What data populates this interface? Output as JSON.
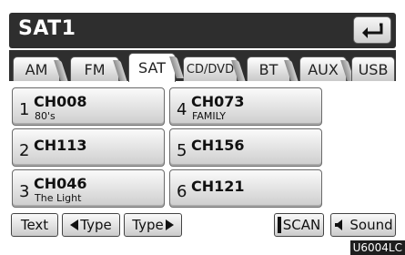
{
  "header": {
    "title": "SAT1"
  },
  "tabs": [
    {
      "label": "AM"
    },
    {
      "label": "FM"
    },
    {
      "label": "SAT",
      "active": true
    },
    {
      "label": "CD/DVD"
    },
    {
      "label": "BT"
    },
    {
      "label": "AUX"
    },
    {
      "label": "USB"
    }
  ],
  "presets": [
    {
      "num": "1",
      "channel": "CH008",
      "name": "80's"
    },
    {
      "num": "2",
      "channel": "CH113",
      "name": ""
    },
    {
      "num": "3",
      "channel": "CH046",
      "name": "The Light"
    },
    {
      "num": "4",
      "channel": "CH073",
      "name": "FAMILY"
    },
    {
      "num": "5",
      "channel": "CH156",
      "name": ""
    },
    {
      "num": "6",
      "channel": "CH121",
      "name": ""
    }
  ],
  "bottom": {
    "text_label": "Text",
    "type_prev_label": "Type",
    "type_next_label": "Type",
    "scan_label": "SCAN",
    "sound_label": "Sound"
  },
  "figure_code": "U6004LC",
  "colors": {
    "bar": "#2e2e2e",
    "button_top": "#fafafa",
    "button_bottom": "#cdcdcd"
  },
  "icons": {
    "back": "back-arrow-icon",
    "sound": "speaker-icon"
  }
}
